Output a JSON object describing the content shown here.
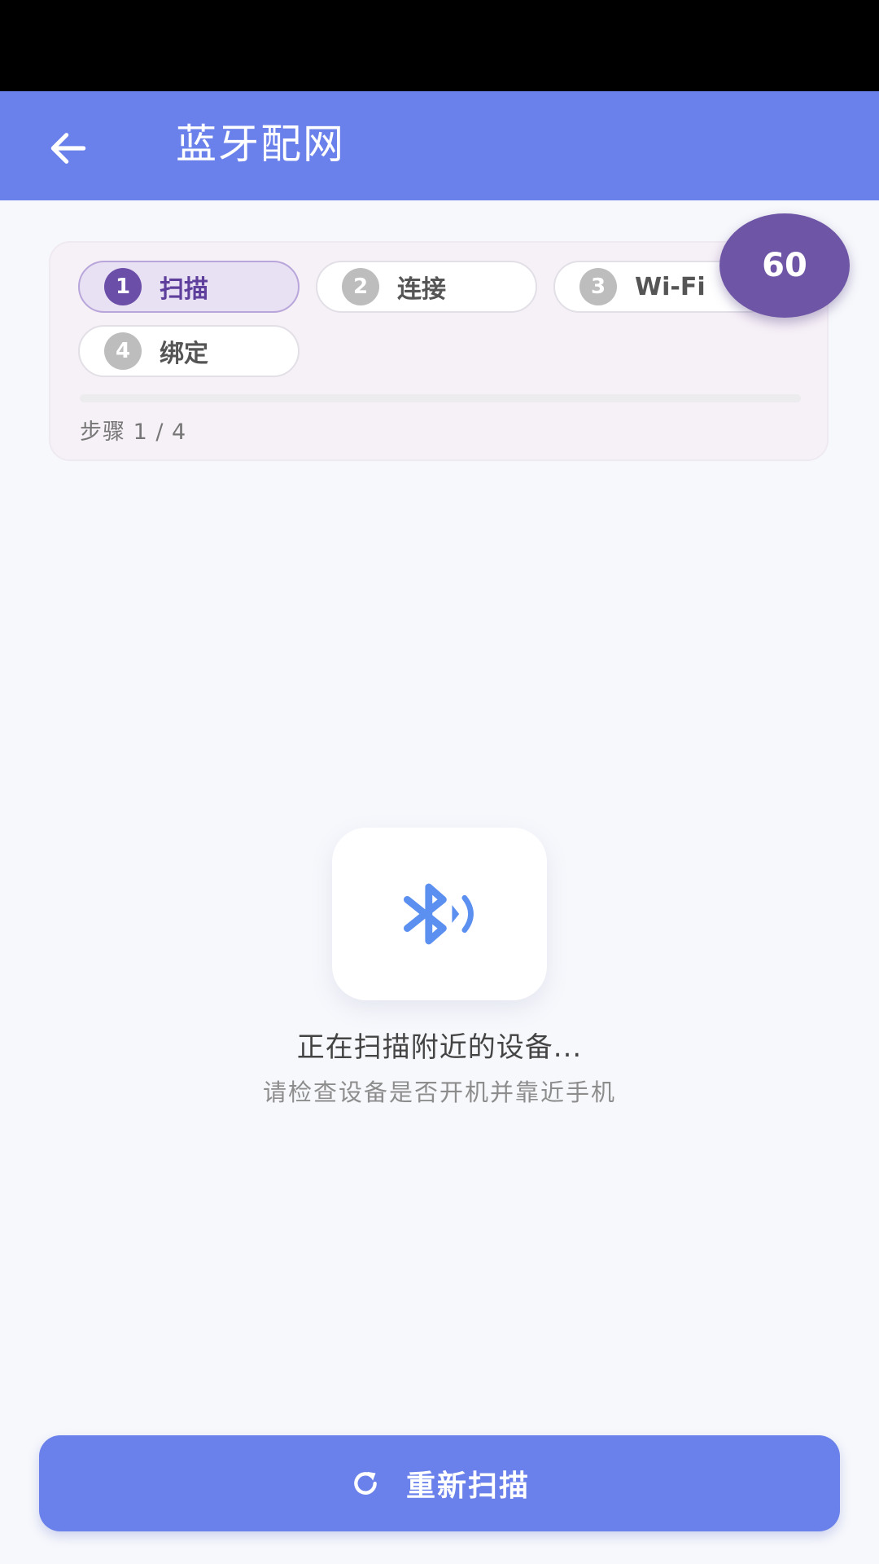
{
  "app_bar": {
    "title": "蓝牙配网",
    "back_icon": "arrow-left-icon"
  },
  "steps": {
    "items": [
      {
        "number": "1",
        "label": "扫描",
        "active": true
      },
      {
        "number": "2",
        "label": "连接",
        "active": false
      },
      {
        "number": "3",
        "label": "Wi-Fi",
        "active": false
      },
      {
        "number": "4",
        "label": "绑定",
        "active": false
      }
    ],
    "step_count": "步骤 1 / 4",
    "progress": 0
  },
  "countdown": {
    "value": "60"
  },
  "scan": {
    "icon": "bluetooth-searching-icon",
    "title": "正在扫描附近的设备...",
    "hint": "请检查设备是否开机并靠近手机"
  },
  "rescan_button": {
    "icon": "refresh-icon",
    "label": "重新扫描"
  },
  "colors": {
    "primary": "#6a80ea",
    "accent_purple": "#6e55a6",
    "active_chip_bg": "#e8e0f3",
    "bluetooth_blue": "#5b8ff0"
  }
}
